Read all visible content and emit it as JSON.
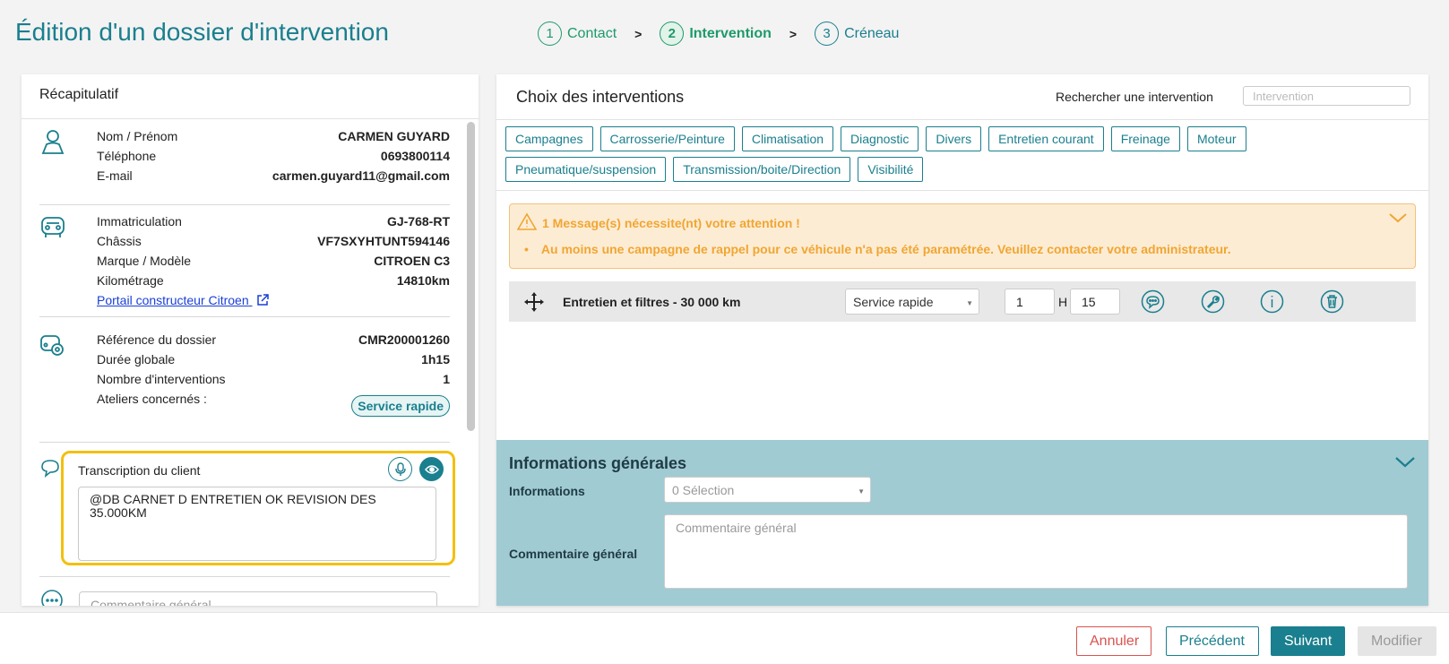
{
  "page_title": "Édition d'un dossier d'intervention",
  "stepper": [
    {
      "num": "1",
      "label": "Contact"
    },
    {
      "num": "2",
      "label": "Intervention"
    },
    {
      "num": "3",
      "label": "Créneau"
    }
  ],
  "stepper_sep": ">",
  "recap": {
    "title": "Récapitulatif",
    "contact": [
      {
        "key": "Nom / Prénom",
        "value": "CARMEN GUYARD"
      },
      {
        "key": "Téléphone",
        "value": "0693800114"
      },
      {
        "key": "E-mail",
        "value": "carmen.guyard11@gmail.com"
      }
    ],
    "vehicle": [
      {
        "key": "Immatriculation",
        "value": "GJ-768-RT"
      },
      {
        "key": "Châssis",
        "value": "VF7SXYHTUNT594146"
      },
      {
        "key": "Marque / Modèle",
        "value": "CITROEN C3"
      },
      {
        "key": "Kilométrage",
        "value": "14810km"
      }
    ],
    "portal_link": "Portail constructeur Citroen",
    "dossier": [
      {
        "key": "Référence du dossier",
        "value": "CMR200001260"
      },
      {
        "key": "Durée globale",
        "value": "1h15"
      },
      {
        "key": "Nombre d'interventions",
        "value": "1"
      }
    ],
    "ateliers_label": "Ateliers concernés :",
    "ateliers_badge": "Service rapide",
    "transcription_label": "Transcription du client",
    "transcription_text": "@DB CARNET D ENTRETIEN OK REVISION DES 35.000KM",
    "comment_placeholder": "Commentaire général"
  },
  "interventions": {
    "title": "Choix des interventions",
    "search_label": "Rechercher une intervention",
    "search_placeholder": "Intervention",
    "categories": [
      "Campagnes",
      "Carrosserie/Peinture",
      "Climatisation",
      "Diagnostic",
      "Divers",
      "Entretien courant",
      "Freinage",
      "Moteur",
      "Pneumatique/suspension",
      "Transmission/boite/Direction",
      "Visibilité"
    ],
    "alert_title": "1 Message(s) nécessite(nt) votre attention !",
    "alert_message": "Au moins une campagne de rappel pour ce véhicule n'a pas été paramétrée. Veuillez contacter votre administrateur.",
    "item": {
      "name": "Entretien et filtres - 30 000 km",
      "workshop": "Service rapide",
      "hours": "1",
      "h_label": "H",
      "minutes": "15"
    }
  },
  "info_gen": {
    "title": "Informations générales",
    "informations_label": "Informations",
    "select_placeholder": "0 Sélection",
    "comment_label": "Commentaire général",
    "comment_placeholder": "Commentaire général"
  },
  "footer": {
    "annuler": "Annuler",
    "precedent": "Précédent",
    "suivant": "Suivant",
    "modifier": "Modifier"
  },
  "colors": {
    "teal": "#1a7f8e",
    "green": "#1e9a6b",
    "warning": "#f0a632",
    "highlight": "#f2c00f",
    "danger": "#d9534f"
  }
}
